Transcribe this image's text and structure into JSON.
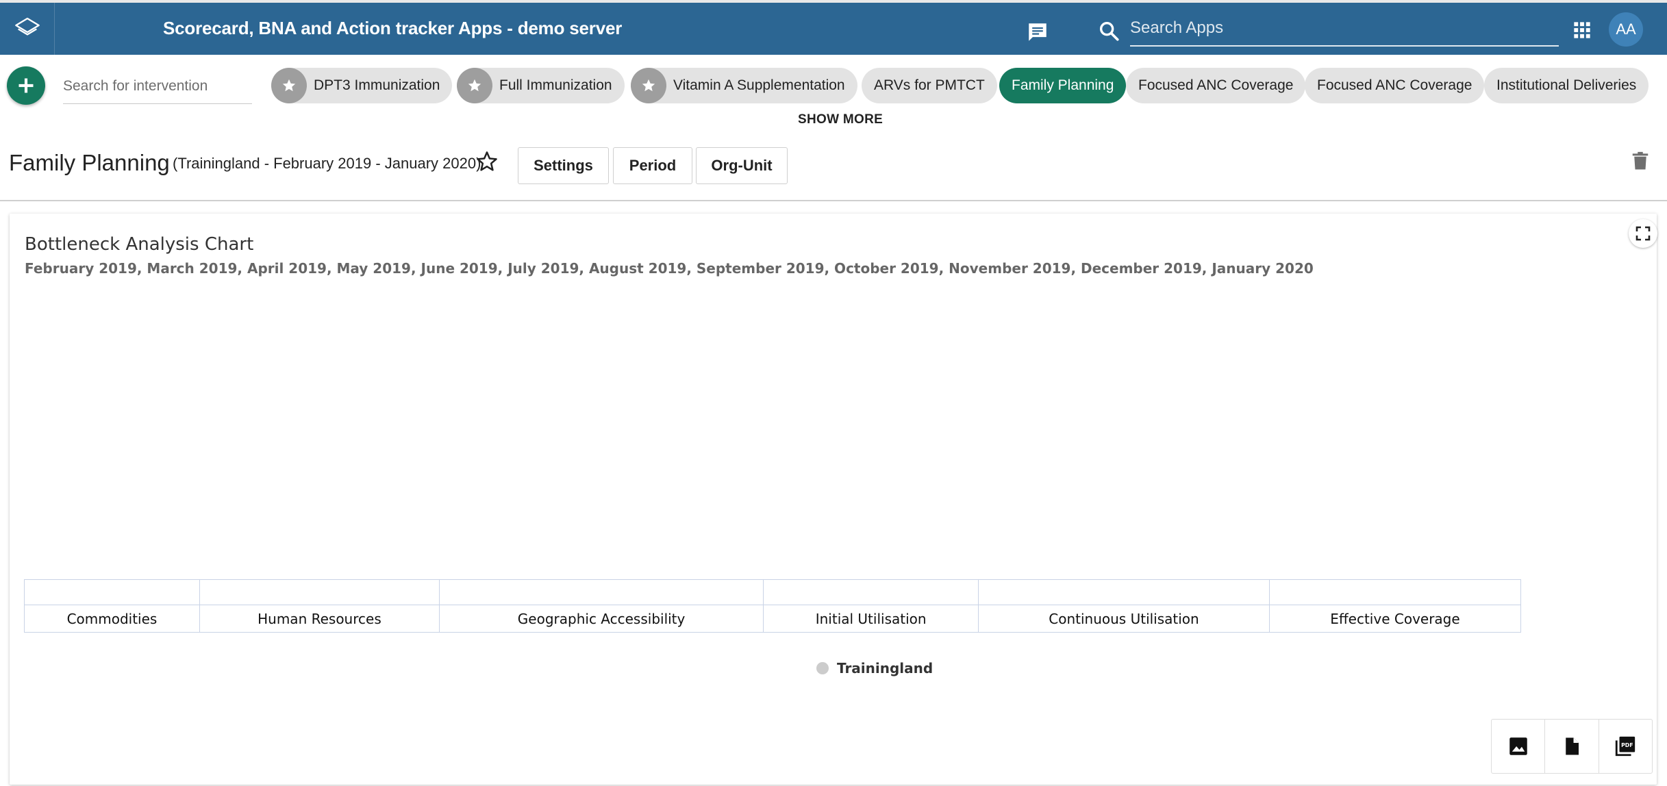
{
  "header": {
    "title": "Scorecard, BNA and Action tracker Apps - demo server",
    "search_placeholder": "Search Apps",
    "user_initials": "AA",
    "icons": [
      "layers-logo-icon",
      "message-icon",
      "search-icon",
      "apps-grid-icon"
    ],
    "color": "#2c6693"
  },
  "interventions": {
    "search_placeholder": "Search for intervention",
    "chips": [
      {
        "label": "DPT3 Immunization",
        "starred": true
      },
      {
        "label": "Full Immunization",
        "starred": true
      },
      {
        "label": "Vitamin A Supplementation",
        "starred": true
      },
      {
        "label": "ARVs for PMTCT",
        "starred": false
      },
      {
        "label": "Family Planning",
        "starred": false,
        "active": true
      },
      {
        "label": "Focused ANC Coverage",
        "starred": false
      },
      {
        "label": "Focused ANC Coverage",
        "starred": false
      },
      {
        "label": "Institutional Deliveries",
        "starred": false
      }
    ],
    "show_more": "SHOW MORE",
    "active_color": "#167a5f"
  },
  "page": {
    "title": "Family Planning",
    "subtitle": "(Trainingland - February 2019 - January 2020)",
    "buttons": {
      "settings": "Settings",
      "period": "Period",
      "org_unit": "Org-Unit"
    }
  },
  "chart_data": {
    "type": "bar",
    "title": "Bottleneck Analysis Chart",
    "subtitle": "February 2019, March 2019, April 2019, May 2019, June 2019, July 2019, August 2019, September 2019, October 2019, November 2019, December 2019, January 2020",
    "categories": [
      "Commodities",
      "Human Resources",
      "Geographic Accessibility",
      "Initial Utilisation",
      "Continuous Utilisation",
      "Effective Coverage"
    ],
    "series": [
      {
        "name": "Trainingland",
        "values": [
          null,
          null,
          null,
          null,
          null,
          null
        ],
        "color": "#cccccc"
      }
    ],
    "legend_placement": "bottom-center"
  },
  "export": {
    "icons": [
      "image-icon",
      "file-icon",
      "pdf-icon"
    ]
  }
}
